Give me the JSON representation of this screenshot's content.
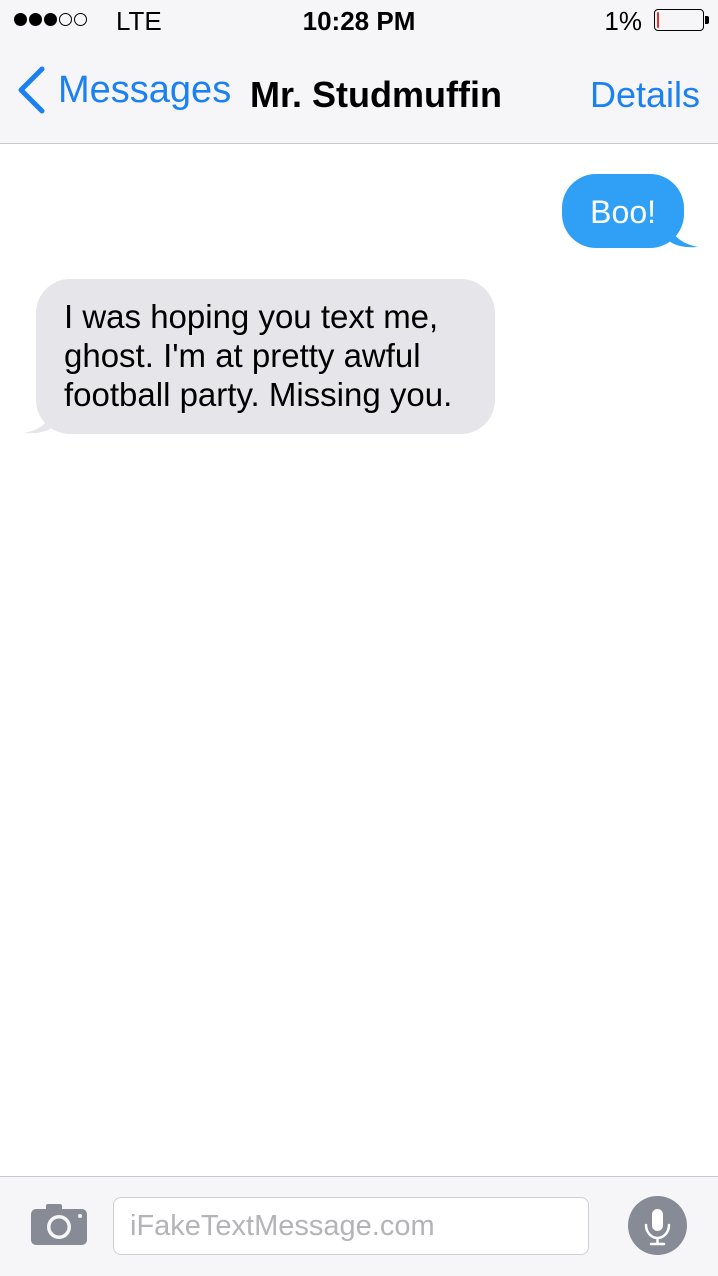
{
  "status_bar": {
    "signal_dots_filled": 3,
    "signal_dots_total": 5,
    "carrier": "LTE",
    "time": "10:28 PM",
    "battery_percent_label": "1%",
    "battery_level": 0.01,
    "battery_color": "#e0342c"
  },
  "nav": {
    "back_label": "Messages",
    "back_icon": "chevron-left-icon",
    "title": "Mr. Studmuffin",
    "details_label": "Details",
    "accent_color": "#1b81f3"
  },
  "messages": [
    {
      "direction": "outgoing",
      "text": "Boo!",
      "bubble_color": "#2fa0f6"
    },
    {
      "direction": "incoming",
      "text": "I was hoping you text me, ghost. I'm at pretty awful football party. Missing you.",
      "bubble_color": "#e6e5ea"
    }
  ],
  "composer": {
    "camera_icon": "camera-icon",
    "placeholder": "iFakeTextMessage.com",
    "mic_icon": "microphone-icon"
  }
}
